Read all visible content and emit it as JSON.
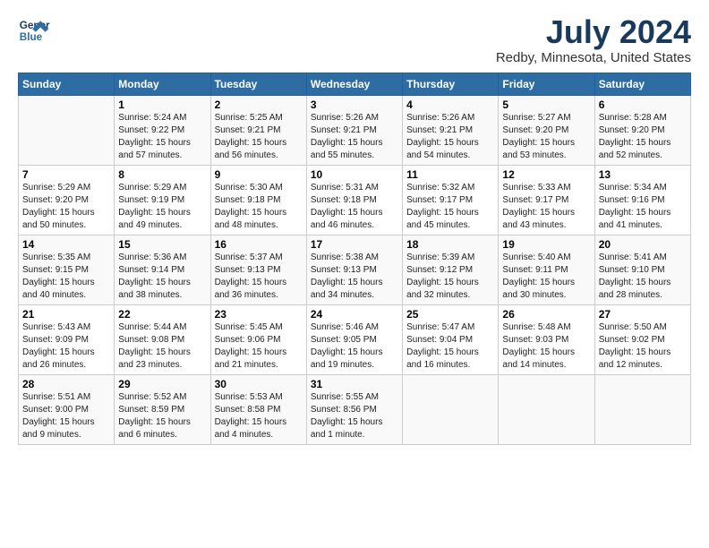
{
  "header": {
    "logo_line1": "General",
    "logo_line2": "Blue",
    "title": "July 2024",
    "subtitle": "Redby, Minnesota, United States"
  },
  "columns": [
    "Sunday",
    "Monday",
    "Tuesday",
    "Wednesday",
    "Thursday",
    "Friday",
    "Saturday"
  ],
  "weeks": [
    [
      {
        "day": "",
        "info": ""
      },
      {
        "day": "1",
        "info": "Sunrise: 5:24 AM\nSunset: 9:22 PM\nDaylight: 15 hours\nand 57 minutes."
      },
      {
        "day": "2",
        "info": "Sunrise: 5:25 AM\nSunset: 9:21 PM\nDaylight: 15 hours\nand 56 minutes."
      },
      {
        "day": "3",
        "info": "Sunrise: 5:26 AM\nSunset: 9:21 PM\nDaylight: 15 hours\nand 55 minutes."
      },
      {
        "day": "4",
        "info": "Sunrise: 5:26 AM\nSunset: 9:21 PM\nDaylight: 15 hours\nand 54 minutes."
      },
      {
        "day": "5",
        "info": "Sunrise: 5:27 AM\nSunset: 9:20 PM\nDaylight: 15 hours\nand 53 minutes."
      },
      {
        "day": "6",
        "info": "Sunrise: 5:28 AM\nSunset: 9:20 PM\nDaylight: 15 hours\nand 52 minutes."
      }
    ],
    [
      {
        "day": "7",
        "info": "Sunrise: 5:29 AM\nSunset: 9:20 PM\nDaylight: 15 hours\nand 50 minutes."
      },
      {
        "day": "8",
        "info": "Sunrise: 5:29 AM\nSunset: 9:19 PM\nDaylight: 15 hours\nand 49 minutes."
      },
      {
        "day": "9",
        "info": "Sunrise: 5:30 AM\nSunset: 9:18 PM\nDaylight: 15 hours\nand 48 minutes."
      },
      {
        "day": "10",
        "info": "Sunrise: 5:31 AM\nSunset: 9:18 PM\nDaylight: 15 hours\nand 46 minutes."
      },
      {
        "day": "11",
        "info": "Sunrise: 5:32 AM\nSunset: 9:17 PM\nDaylight: 15 hours\nand 45 minutes."
      },
      {
        "day": "12",
        "info": "Sunrise: 5:33 AM\nSunset: 9:17 PM\nDaylight: 15 hours\nand 43 minutes."
      },
      {
        "day": "13",
        "info": "Sunrise: 5:34 AM\nSunset: 9:16 PM\nDaylight: 15 hours\nand 41 minutes."
      }
    ],
    [
      {
        "day": "14",
        "info": "Sunrise: 5:35 AM\nSunset: 9:15 PM\nDaylight: 15 hours\nand 40 minutes."
      },
      {
        "day": "15",
        "info": "Sunrise: 5:36 AM\nSunset: 9:14 PM\nDaylight: 15 hours\nand 38 minutes."
      },
      {
        "day": "16",
        "info": "Sunrise: 5:37 AM\nSunset: 9:13 PM\nDaylight: 15 hours\nand 36 minutes."
      },
      {
        "day": "17",
        "info": "Sunrise: 5:38 AM\nSunset: 9:13 PM\nDaylight: 15 hours\nand 34 minutes."
      },
      {
        "day": "18",
        "info": "Sunrise: 5:39 AM\nSunset: 9:12 PM\nDaylight: 15 hours\nand 32 minutes."
      },
      {
        "day": "19",
        "info": "Sunrise: 5:40 AM\nSunset: 9:11 PM\nDaylight: 15 hours\nand 30 minutes."
      },
      {
        "day": "20",
        "info": "Sunrise: 5:41 AM\nSunset: 9:10 PM\nDaylight: 15 hours\nand 28 minutes."
      }
    ],
    [
      {
        "day": "21",
        "info": "Sunrise: 5:43 AM\nSunset: 9:09 PM\nDaylight: 15 hours\nand 26 minutes."
      },
      {
        "day": "22",
        "info": "Sunrise: 5:44 AM\nSunset: 9:08 PM\nDaylight: 15 hours\nand 23 minutes."
      },
      {
        "day": "23",
        "info": "Sunrise: 5:45 AM\nSunset: 9:06 PM\nDaylight: 15 hours\nand 21 minutes."
      },
      {
        "day": "24",
        "info": "Sunrise: 5:46 AM\nSunset: 9:05 PM\nDaylight: 15 hours\nand 19 minutes."
      },
      {
        "day": "25",
        "info": "Sunrise: 5:47 AM\nSunset: 9:04 PM\nDaylight: 15 hours\nand 16 minutes."
      },
      {
        "day": "26",
        "info": "Sunrise: 5:48 AM\nSunset: 9:03 PM\nDaylight: 15 hours\nand 14 minutes."
      },
      {
        "day": "27",
        "info": "Sunrise: 5:50 AM\nSunset: 9:02 PM\nDaylight: 15 hours\nand 12 minutes."
      }
    ],
    [
      {
        "day": "28",
        "info": "Sunrise: 5:51 AM\nSunset: 9:00 PM\nDaylight: 15 hours\nand 9 minutes."
      },
      {
        "day": "29",
        "info": "Sunrise: 5:52 AM\nSunset: 8:59 PM\nDaylight: 15 hours\nand 6 minutes."
      },
      {
        "day": "30",
        "info": "Sunrise: 5:53 AM\nSunset: 8:58 PM\nDaylight: 15 hours\nand 4 minutes."
      },
      {
        "day": "31",
        "info": "Sunrise: 5:55 AM\nSunset: 8:56 PM\nDaylight: 15 hours\nand 1 minute."
      },
      {
        "day": "",
        "info": ""
      },
      {
        "day": "",
        "info": ""
      },
      {
        "day": "",
        "info": ""
      }
    ]
  ]
}
